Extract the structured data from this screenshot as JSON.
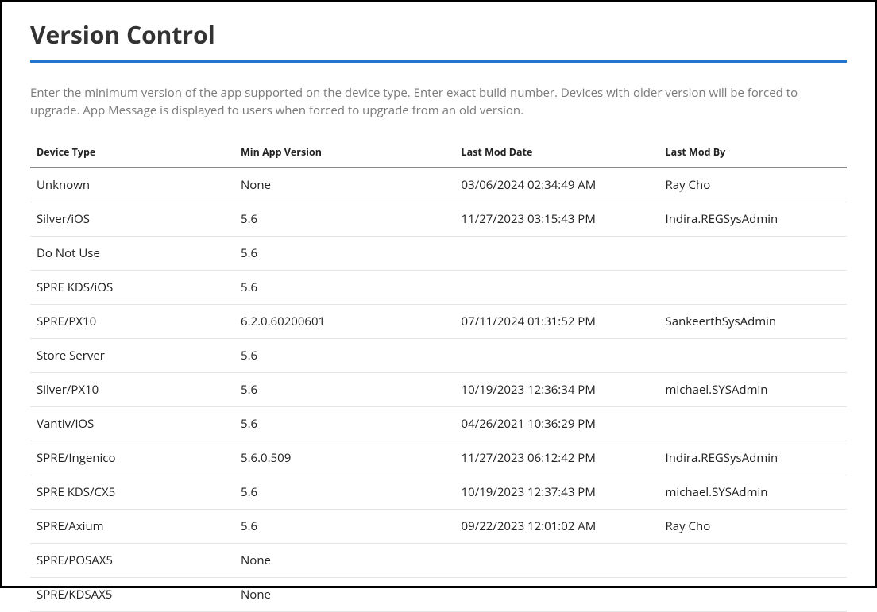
{
  "header": {
    "title": "Version Control"
  },
  "description": "Enter the minimum version of the app supported on the device type. Enter exact build number. Devices with older version will be forced to upgrade. App Message is displayed to users when forced to upgrade from an old version.",
  "table": {
    "columns": {
      "deviceType": "Device Type",
      "minAppVersion": "Min App Version",
      "lastModDate": "Last Mod Date",
      "lastModBy": "Last Mod By"
    },
    "rows": [
      {
        "deviceType": "Unknown",
        "minAppVersion": "None",
        "lastModDate": "03/06/2024 02:34:49 AM",
        "lastModBy": "Ray Cho"
      },
      {
        "deviceType": "Silver/iOS",
        "minAppVersion": "5.6",
        "lastModDate": "11/27/2023 03:15:43 PM",
        "lastModBy": "Indira.REGSysAdmin"
      },
      {
        "deviceType": "Do Not Use",
        "minAppVersion": "5.6",
        "lastModDate": "",
        "lastModBy": ""
      },
      {
        "deviceType": "SPRE KDS/iOS",
        "minAppVersion": "5.6",
        "lastModDate": "",
        "lastModBy": ""
      },
      {
        "deviceType": "SPRE/PX10",
        "minAppVersion": "6.2.0.60200601",
        "lastModDate": "07/11/2024 01:31:52 PM",
        "lastModBy": "SankeerthSysAdmin"
      },
      {
        "deviceType": "Store Server",
        "minAppVersion": "5.6",
        "lastModDate": "",
        "lastModBy": ""
      },
      {
        "deviceType": "Silver/PX10",
        "minAppVersion": "5.6",
        "lastModDate": "10/19/2023 12:36:34 PM",
        "lastModBy": "michael.SYSAdmin"
      },
      {
        "deviceType": "Vantiv/iOS",
        "minAppVersion": "5.6",
        "lastModDate": "04/26/2021 10:36:29 PM",
        "lastModBy": ""
      },
      {
        "deviceType": "SPRE/Ingenico",
        "minAppVersion": "5.6.0.509",
        "lastModDate": "11/27/2023 06:12:42 PM",
        "lastModBy": "Indira.REGSysAdmin"
      },
      {
        "deviceType": "SPRE KDS/CX5",
        "minAppVersion": "5.6",
        "lastModDate": "10/19/2023 12:37:43 PM",
        "lastModBy": "michael.SYSAdmin"
      },
      {
        "deviceType": "SPRE/Axium",
        "minAppVersion": "5.6",
        "lastModDate": "09/22/2023 12:01:02 AM",
        "lastModBy": "Ray Cho"
      },
      {
        "deviceType": "SPRE/POSAX5",
        "minAppVersion": "None",
        "lastModDate": "",
        "lastModBy": ""
      },
      {
        "deviceType": "SPRE/KDSAX5",
        "minAppVersion": "None",
        "lastModDate": "",
        "lastModBy": ""
      }
    ]
  }
}
